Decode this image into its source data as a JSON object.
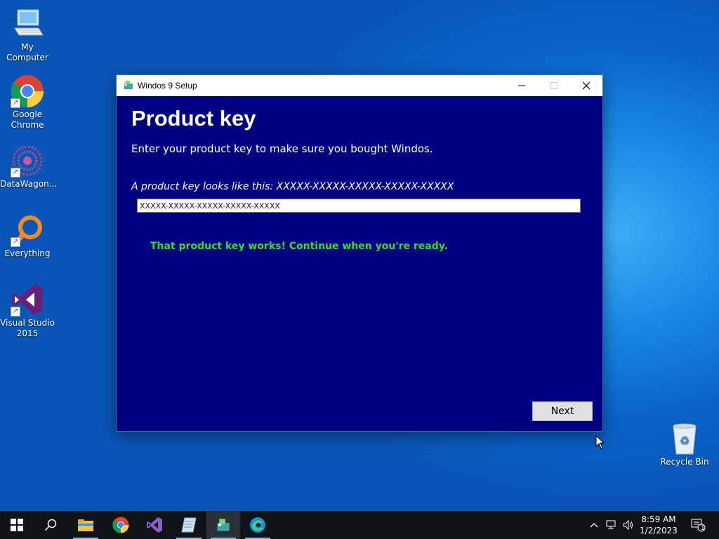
{
  "desktop": {
    "icons": [
      {
        "label": "My Computer"
      },
      {
        "label": "Google Chrome"
      },
      {
        "label": "DataWagon..."
      },
      {
        "label": "Everything"
      },
      {
        "label": "Visual Studio 2015"
      },
      {
        "label": "Recycle Bin"
      }
    ]
  },
  "window": {
    "title": "Windos 9 Setup",
    "heading": "Product key",
    "subtitle": "Enter your product key to make sure you bought Windos.",
    "hint": "A product key looks like this: XXXXX-XXXXX-XXXXX-XXXXX-XXXXX",
    "key_value": "XXXXX-XXXXX-XXXXX-XXXXX-XXXXX",
    "status": "That product key works! Continue when you're ready.",
    "next_label": "Next",
    "colors": {
      "background": "#000080",
      "status": "#2ee02e"
    }
  },
  "taskbar": {
    "apps": [
      "start-icon",
      "search-icon",
      "file-explorer-icon",
      "chrome-icon",
      "visual-studio-icon",
      "app-icon",
      "setup-icon",
      "edge-icon"
    ],
    "clock": {
      "time": "8:59 AM",
      "date": "1/2/2023"
    },
    "notification_count": "1"
  }
}
